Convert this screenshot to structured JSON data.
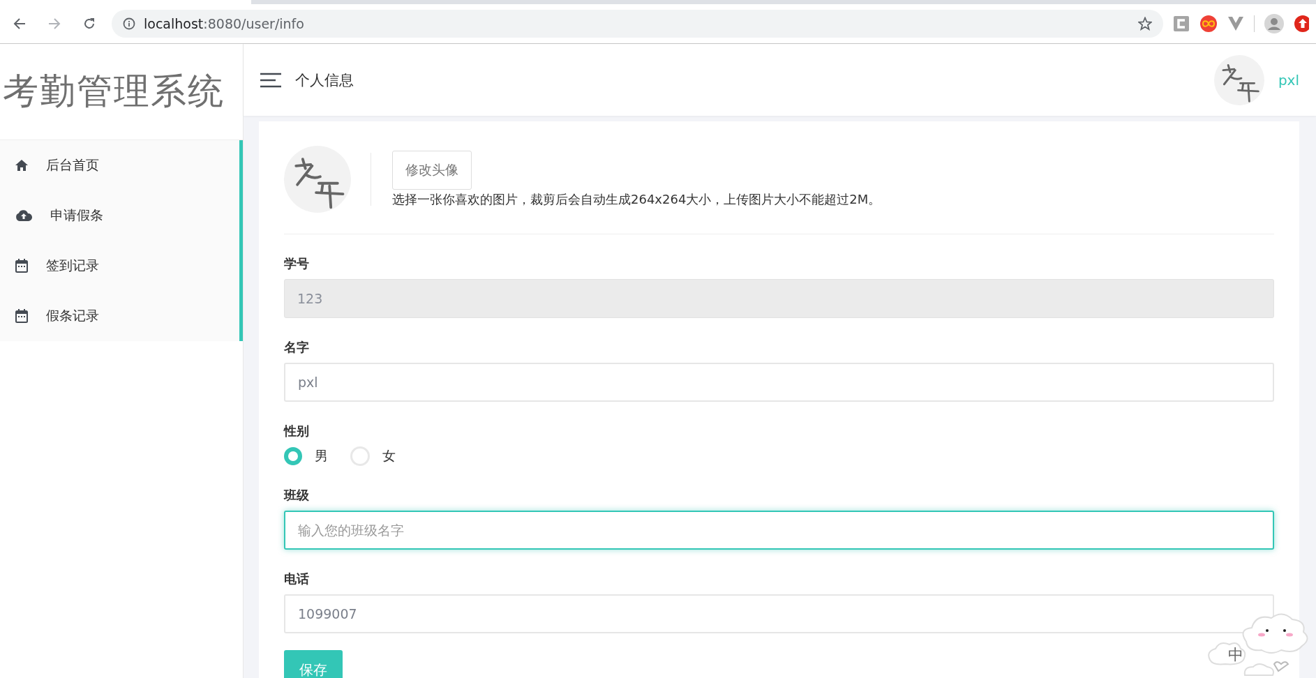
{
  "browser": {
    "url_host": "localhost",
    "url_path": ":8080/user/info"
  },
  "sidebar": {
    "logo": "考勤管理系统",
    "items": [
      {
        "label": "后台首页",
        "selected": false
      },
      {
        "label": "申请假条",
        "selected": false
      },
      {
        "label": "签到记录",
        "selected": false
      },
      {
        "label": "假条记录",
        "selected": false
      }
    ]
  },
  "header": {
    "title": "个人信息",
    "user": "pxl"
  },
  "profile": {
    "button": "修改头像",
    "hint": "选择一张你喜欢的图片，裁剪后会自动生成264x264大小，上传图片大小不能超过2M。"
  },
  "fields": [
    {
      "kind": "text",
      "label": "学号",
      "value": "123",
      "disabled": true,
      "focused": false
    },
    {
      "kind": "text",
      "label": "名字",
      "value": "pxl",
      "disabled": false,
      "focused": false
    },
    {
      "kind": "radio",
      "label": "性别",
      "options": [
        {
          "label": "男",
          "selected": true
        },
        {
          "label": "女",
          "selected": false
        }
      ]
    },
    {
      "kind": "text",
      "label": "班级",
      "placeholder": "输入您的班级名字",
      "disabled": false,
      "focused": true
    },
    {
      "kind": "text",
      "label": "电话",
      "value": "1099007",
      "disabled": false,
      "focused": false
    }
  ],
  "save_button": "保存",
  "ime": {
    "label": "中"
  }
}
